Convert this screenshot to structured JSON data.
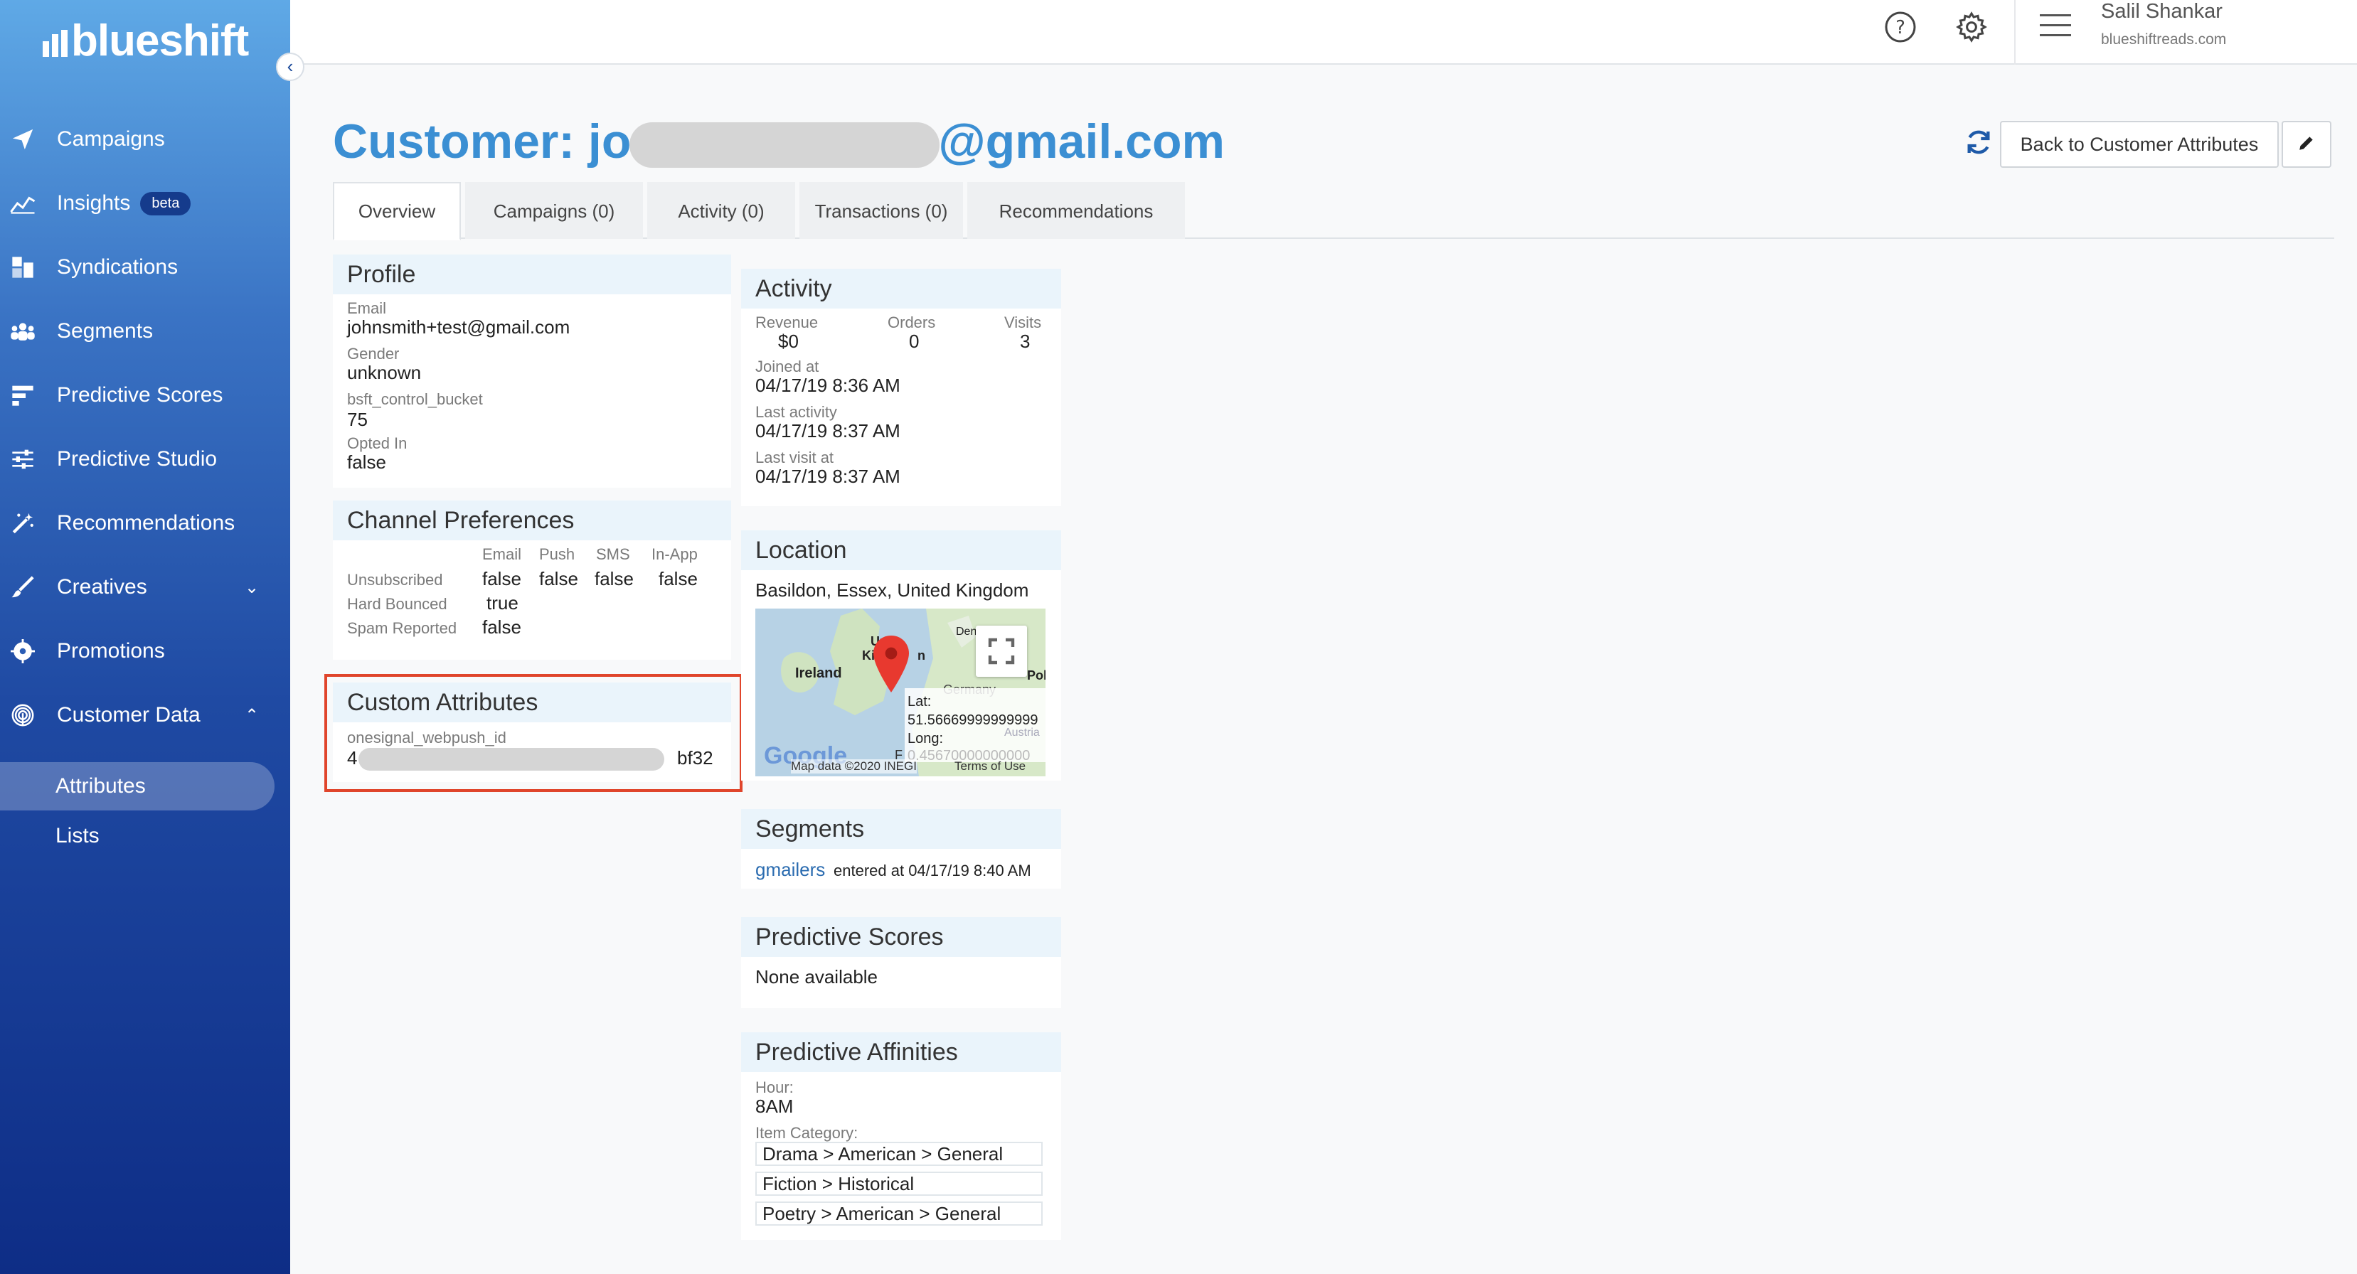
{
  "brand": {
    "name": "blueshift"
  },
  "sidebar": {
    "items": [
      {
        "label": "Campaigns"
      },
      {
        "label": "Insights",
        "badge": "beta"
      },
      {
        "label": "Syndications"
      },
      {
        "label": "Segments"
      },
      {
        "label": "Predictive Scores"
      },
      {
        "label": "Predictive Studio"
      },
      {
        "label": "Recommendations"
      },
      {
        "label": "Creatives"
      },
      {
        "label": "Promotions"
      },
      {
        "label": "Customer Data"
      }
    ],
    "subitems": [
      {
        "label": "Attributes",
        "active": true
      },
      {
        "label": "Lists"
      }
    ]
  },
  "topbar": {
    "user_name": "Salil Shankar",
    "user_domain": "blueshiftreads.com"
  },
  "header": {
    "title_prefix": "Customer: jo",
    "title_suffix": "@gmail.com",
    "back_label": "Back to Customer Attributes"
  },
  "tabs": [
    {
      "label": "Overview",
      "active": true
    },
    {
      "label": "Campaigns (0)"
    },
    {
      "label": "Activity (0)"
    },
    {
      "label": "Transactions (0)"
    },
    {
      "label": "Recommendations"
    }
  ],
  "profile": {
    "title": "Profile",
    "fields": [
      {
        "label": "Email",
        "value": "johnsmith+test@gmail.com"
      },
      {
        "label": "Gender",
        "value": "unknown"
      },
      {
        "label": "bsft_control_bucket",
        "value": "75"
      },
      {
        "label": "Opted In",
        "value": "false"
      }
    ]
  },
  "channel": {
    "title": "Channel Preferences",
    "columns": [
      "Email",
      "Push",
      "SMS",
      "In-App"
    ],
    "rows": [
      {
        "label": "Unsubscribed",
        "values": [
          "false",
          "false",
          "false",
          "false"
        ]
      },
      {
        "label": "Hard Bounced",
        "values": [
          "true",
          "",
          "",
          ""
        ]
      },
      {
        "label": "Spam Reported",
        "values": [
          "false",
          "",
          "",
          ""
        ]
      }
    ]
  },
  "custom": {
    "title": "Custom Attributes",
    "label": "onesignal_webpush_id",
    "value_start": "4",
    "value_end": "bf32"
  },
  "activity": {
    "title": "Activity",
    "stats": [
      {
        "label": "Revenue",
        "value": "$0"
      },
      {
        "label": "Orders",
        "value": "0"
      },
      {
        "label": "Visits",
        "value": "3"
      }
    ],
    "fields": [
      {
        "label": "Joined at",
        "value": "04/17/19 8:36 AM"
      },
      {
        "label": "Last activity",
        "value": "04/17/19 8:37 AM"
      },
      {
        "label": "Last visit at",
        "value": "04/17/19 8:37 AM"
      }
    ]
  },
  "location": {
    "title": "Location",
    "place": "Basildon, Essex, United Kingdom",
    "map": {
      "labels": [
        "Ireland",
        "Un",
        "Kin",
        "n",
        "Den",
        "Germany",
        "Pol"
      ],
      "lat_label": "Lat:",
      "lat_value": "51.56669999999999",
      "long_label": "Long:",
      "long_value": "0.45670000000000",
      "attribution": "Map data ©2020 INEGI",
      "terms": "Terms of Use",
      "logo": "Google",
      "faded": "Austria",
      "partial": "F"
    }
  },
  "segments": {
    "title": "Segments",
    "link": "gmailers",
    "entered": "entered at 04/17/19 8:40 AM"
  },
  "predictive_scores": {
    "title": "Predictive Scores",
    "empty": "None available"
  },
  "affinities": {
    "title": "Predictive Affinities",
    "hour_label": "Hour:",
    "hour_value": "8AM",
    "category_label": "Item Category:",
    "categories": [
      "Drama > American > General",
      "Fiction > Historical",
      "Poetry > American > General"
    ]
  },
  "colors": {
    "accent": "#3b8fd3",
    "highlight": "#e0452b",
    "card_header": "#eaf4fb"
  }
}
